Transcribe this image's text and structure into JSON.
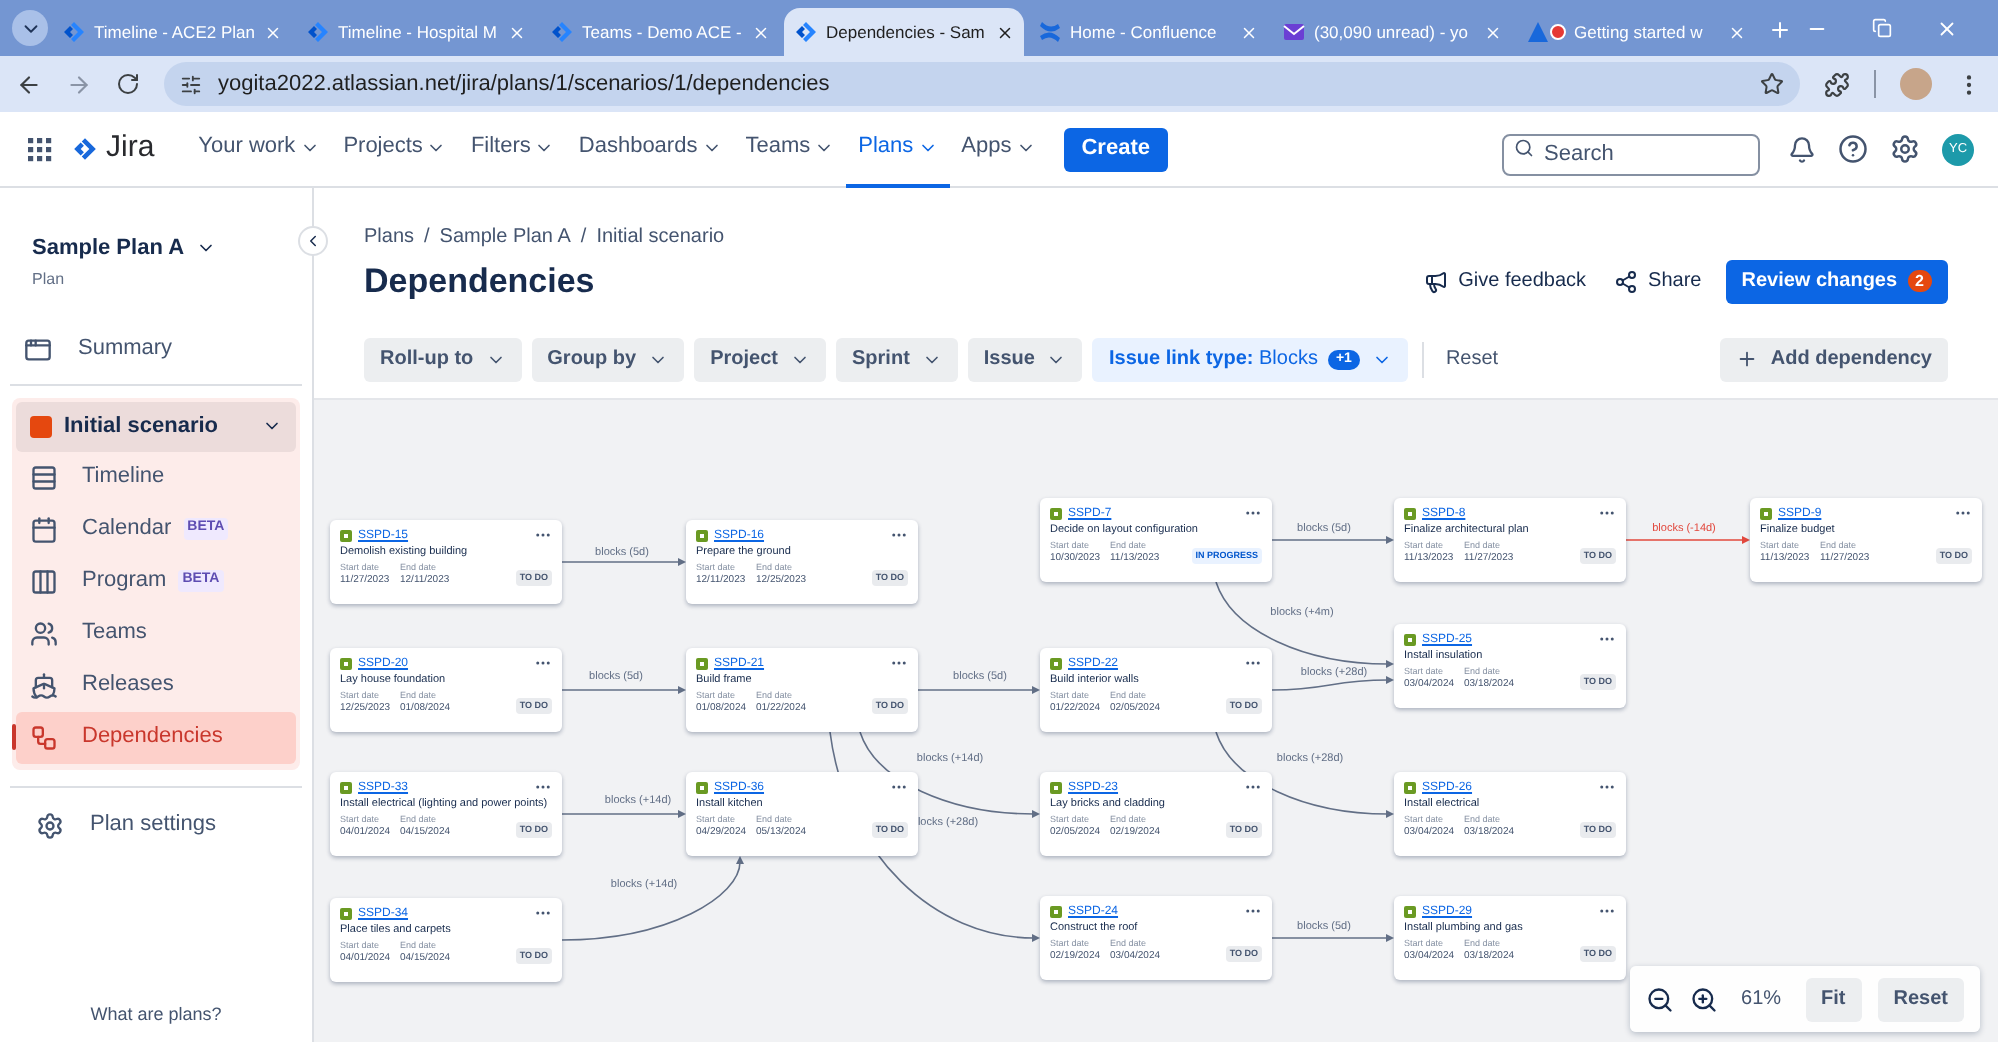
{
  "browser": {
    "tabs": [
      {
        "title": "Timeline - ACE2 Plan",
        "kind": "jira",
        "selected": false,
        "recording": false
      },
      {
        "title": "Timeline - Hospital M",
        "kind": "jira",
        "selected": false,
        "recording": false
      },
      {
        "title": "Teams - Demo ACE -",
        "kind": "jira",
        "selected": false,
        "recording": false
      },
      {
        "title": "Dependencies - Sam",
        "kind": "jira",
        "selected": true,
        "recording": false
      },
      {
        "title": "Home - Confluence",
        "kind": "confluence",
        "selected": false,
        "recording": false
      },
      {
        "title": "(30,090 unread) - yo",
        "kind": "mail",
        "selected": false,
        "recording": false
      },
      {
        "title": "Getting started w",
        "kind": "atlassian",
        "selected": false,
        "recording": true
      }
    ],
    "url": "yogita2022.atlassian.net/jira/plans/1/scenarios/1/dependencies"
  },
  "topnav": {
    "product": "Jira",
    "items": [
      {
        "label": "Your work",
        "selected": false
      },
      {
        "label": "Projects",
        "selected": false
      },
      {
        "label": "Filters",
        "selected": false
      },
      {
        "label": "Dashboards",
        "selected": false
      },
      {
        "label": "Teams",
        "selected": false
      },
      {
        "label": "Plans",
        "selected": true
      },
      {
        "label": "Apps",
        "selected": false
      }
    ],
    "create": "Create",
    "search": {
      "placeholder": "Search"
    },
    "avatar": "YC"
  },
  "sidebar": {
    "plan_name": "Sample Plan A",
    "plan_type": "Plan",
    "summary": "Summary",
    "scenario": {
      "name": "Initial scenario",
      "expanded": true,
      "color": "#e5480f"
    },
    "items": [
      {
        "label": "Timeline",
        "kind": "timeline",
        "selected": false
      },
      {
        "label": "Calendar",
        "kind": "calendar",
        "badge": "BETA",
        "selected": false
      },
      {
        "label": "Program",
        "kind": "program",
        "badge": "BETA",
        "selected": false
      },
      {
        "label": "Teams",
        "kind": "teams",
        "selected": false
      },
      {
        "label": "Releases",
        "kind": "releases",
        "selected": false
      },
      {
        "label": "Dependencies",
        "kind": "dependencies",
        "selected": true
      }
    ],
    "settings": "Plan settings",
    "help": "What are plans?"
  },
  "header": {
    "breadcrumbs": [
      "Plans",
      "/",
      "Sample Plan A",
      "/",
      "Initial scenario"
    ],
    "title": "Dependencies",
    "feedback": "Give feedback",
    "share": "Share",
    "review": {
      "label": "Review changes",
      "count": "2"
    }
  },
  "filters": [
    {
      "label": "Roll-up to",
      "active": false
    },
    {
      "label": "Group by",
      "active": false
    },
    {
      "label": "Project",
      "active": false
    },
    {
      "label": "Sprint",
      "active": false
    },
    {
      "label": "Issue",
      "active": false
    },
    {
      "label": "**Issue link type:** Blocks",
      "badge": "+1",
      "active": true
    }
  ],
  "reset": "Reset",
  "add_dependency": "Add dependency",
  "issues": [
    {
      "key": "SSPD-15",
      "title": "Demolish existing building",
      "start_label": "Start date",
      "start": "11/27/2023",
      "end_label": "End date",
      "end": "12/11/2023",
      "status": "TO DO",
      "kind": "todo"
    },
    {
      "key": "SSPD-20",
      "title": "Lay house foundation",
      "start_label": "Start date",
      "start": "12/25/2023",
      "end_label": "End date",
      "end": "01/08/2024",
      "status": "TO DO",
      "kind": "todo"
    },
    {
      "key": "SSPD-33",
      "title": "Install electrical (lighting and power points)",
      "start_label": "Start date",
      "start": "04/01/2024",
      "end_label": "End date",
      "end": "04/15/2024",
      "status": "TO DO",
      "kind": "todo"
    },
    {
      "key": "SSPD-34",
      "title": "Place tiles and carpets",
      "start_label": "Start date",
      "start": "04/01/2024",
      "end_label": "End date",
      "end": "04/15/2024",
      "status": "TO DO",
      "kind": "todo"
    },
    {
      "key": "SSPD-16",
      "title": "Prepare the ground",
      "start_label": "Start date",
      "start": "12/11/2023",
      "end_label": "End date",
      "end": "12/25/2023",
      "status": "TO DO",
      "kind": "todo"
    },
    {
      "key": "SSPD-21",
      "title": "Build frame",
      "start_label": "Start date",
      "start": "01/08/2024",
      "end_label": "End date",
      "end": "01/22/2024",
      "status": "TO DO",
      "kind": "todo"
    },
    {
      "key": "SSPD-36",
      "title": "Install kitchen",
      "start_label": "Start date",
      "start": "04/29/2024",
      "end_label": "End date",
      "end": "05/13/2024",
      "status": "TO DO",
      "kind": "todo"
    },
    {
      "key": "SSPD-7",
      "title": "Decide on layout configuration",
      "start_label": "Start date",
      "start": "10/30/2023",
      "end_label": "End date",
      "end": "11/13/2023",
      "status": "IN PROGRESS",
      "kind": "in_progress"
    },
    {
      "key": "SSPD-22",
      "title": "Build interior walls",
      "start_label": "Start date",
      "start": "01/22/2024",
      "end_label": "End date",
      "end": "02/05/2024",
      "status": "TO DO",
      "kind": "todo"
    },
    {
      "key": "SSPD-23",
      "title": "Lay bricks and cladding",
      "start_label": "Start date",
      "start": "02/05/2024",
      "end_label": "End date",
      "end": "02/19/2024",
      "status": "TO DO",
      "kind": "todo"
    },
    {
      "key": "SSPD-24",
      "title": "Construct the roof",
      "start_label": "Start date",
      "start": "02/19/2024",
      "end_label": "End date",
      "end": "03/04/2024",
      "status": "TO DO",
      "kind": "todo"
    },
    {
      "key": "SSPD-8",
      "title": "Finalize architectural plan",
      "start_label": "Start date",
      "start": "11/13/2023",
      "end_label": "End date",
      "end": "11/27/2023",
      "status": "TO DO",
      "kind": "todo"
    },
    {
      "key": "SSPD-25",
      "title": "Install insulation",
      "start_label": "Start date",
      "start": "03/04/2024",
      "end_label": "End date",
      "end": "03/18/2024",
      "status": "TO DO",
      "kind": "todo"
    },
    {
      "key": "SSPD-26",
      "title": "Install electrical",
      "start_label": "Start date",
      "start": "03/04/2024",
      "end_label": "End date",
      "end": "03/18/2024",
      "status": "TO DO",
      "kind": "todo"
    },
    {
      "key": "SSPD-29",
      "title": "Install plumbing and gas",
      "start_label": "Start date",
      "start": "03/04/2024",
      "end_label": "End date",
      "end": "03/18/2024",
      "status": "TO DO",
      "kind": "todo"
    },
    {
      "key": "SSPD-9",
      "title": "Finalize budget",
      "start_label": "Start date",
      "start": "11/13/2023",
      "end_label": "End date",
      "end": "11/27/2023",
      "status": "TO DO",
      "kind": "todo"
    }
  ],
  "links": [
    {
      "label": "blocks (5d)",
      "kind": "normal"
    },
    {
      "label": "blocks (5d)",
      "kind": "normal"
    },
    {
      "label": "blocks (+14d)",
      "kind": "normal"
    },
    {
      "label": "blocks (+14d)",
      "kind": "normal"
    },
    {
      "label": "blocks (5d)",
      "kind": "normal"
    },
    {
      "label": "blocks (+14d)",
      "kind": "normal"
    },
    {
      "label": "locks (+28d)",
      "kind": "normal"
    },
    {
      "label": "blocks (5d)",
      "kind": "normal"
    },
    {
      "label": "blocks (+4m)",
      "kind": "normal"
    },
    {
      "label": "blocks (+28d)",
      "kind": "normal"
    },
    {
      "label": "blocks (+28d)",
      "kind": "normal"
    },
    {
      "label": "blocks (5d)",
      "kind": "normal"
    },
    {
      "label": "blocks (-14d)",
      "kind": "violation"
    }
  ],
  "zoom": {
    "value": "61%",
    "fit": "Fit",
    "reset": "Reset"
  }
}
